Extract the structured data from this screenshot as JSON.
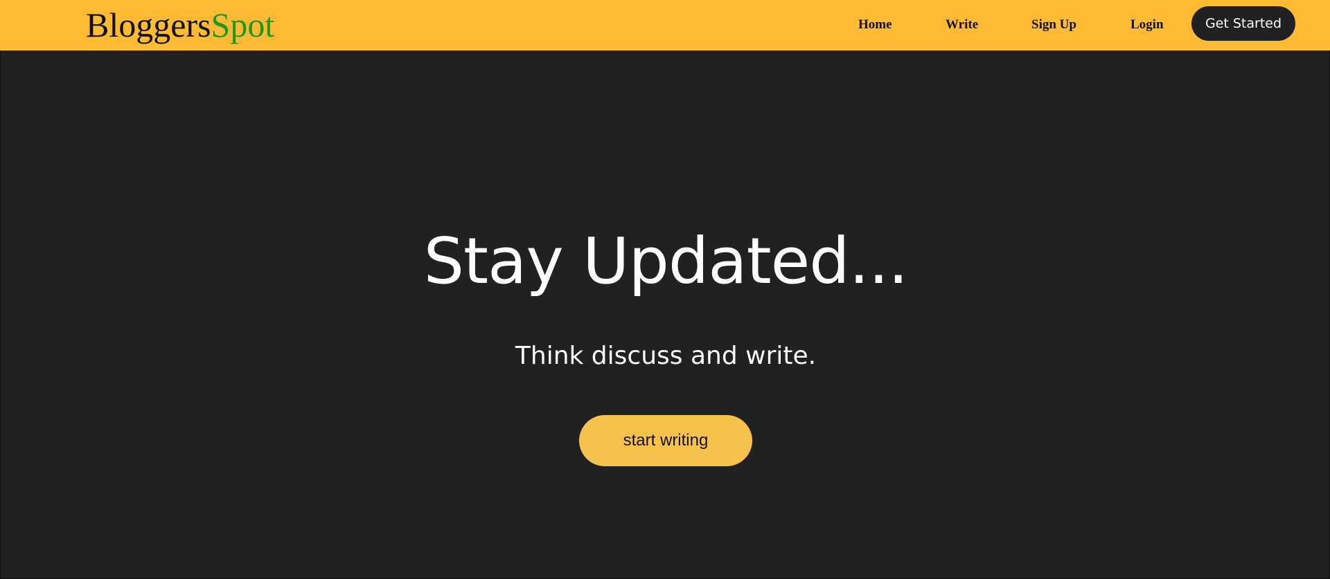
{
  "navbar": {
    "logo": {
      "part1": "Bloggers",
      "part2": "Spot"
    },
    "links": {
      "home": "Home",
      "write": "Write",
      "signup": "Sign Up",
      "login": "Login"
    },
    "cta_label": "Get Started"
  },
  "hero": {
    "title": "Stay Updated...",
    "subtitle": "Think discuss and write.",
    "button_label": "start writing"
  },
  "colors": {
    "navbar_bg": "#fdba32",
    "page_bg": "#212121",
    "logo_accent": "#22961a",
    "button_bg": "#f7c24b",
    "text_light": "#ffffff",
    "text_dark": "#111111"
  }
}
